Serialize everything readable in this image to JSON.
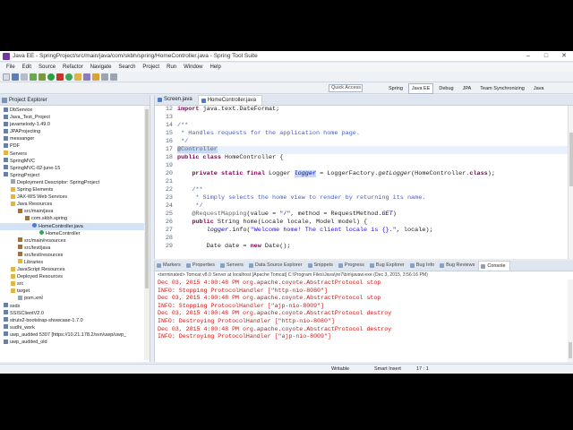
{
  "window": {
    "title": "Java EE - SpringProject/src/main/java/com/skbh/spring/HomeController.java - Spring Tool Suite"
  },
  "menu": [
    "File",
    "Edit",
    "Source",
    "Refactor",
    "Navigate",
    "Search",
    "Project",
    "Run",
    "Window",
    "Help"
  ],
  "quick_access": "Quick Access",
  "perspectives": [
    "Spring",
    "Java EE",
    "Debug",
    "JPA",
    "Team Synchronizing",
    "Java"
  ],
  "explorer": {
    "title": "Project Explorer",
    "items": [
      {
        "label": "DbService",
        "icon": "project-icon"
      },
      {
        "label": "Java_Test_Project",
        "icon": "project-icon"
      },
      {
        "label": "javamelody-1.49.0",
        "icon": "project-icon"
      },
      {
        "label": "JPAProjecting",
        "icon": "project-icon"
      },
      {
        "label": "messanger",
        "icon": "project-icon"
      },
      {
        "label": "PDF",
        "icon": "project-icon"
      },
      {
        "label": "Servers",
        "icon": "folder-icon"
      },
      {
        "label": "SpringMVC",
        "icon": "project-icon"
      },
      {
        "label": "SpringMVC-02-june-15",
        "icon": "project-icon"
      },
      {
        "label": "SpringProject",
        "icon": "project-icon"
      },
      {
        "label": "Deployment Descriptor: SpringProject",
        "icon": "file-icon"
      },
      {
        "label": "Spring Elements",
        "icon": "folder-icon"
      },
      {
        "label": "JAX-WS Web Services",
        "icon": "folder-icon"
      },
      {
        "label": "Java Resources",
        "icon": "folder-icon"
      },
      {
        "label": "src/main/java",
        "icon": "package-icon"
      },
      {
        "label": "com.skbh.spring",
        "icon": "package-icon"
      },
      {
        "label": "HomeController.java",
        "icon": "java-icon"
      },
      {
        "label": "HomeController",
        "icon": "class-icon"
      },
      {
        "label": "src/main/resources",
        "icon": "package-icon"
      },
      {
        "label": "src/test/java",
        "icon": "package-icon"
      },
      {
        "label": "src/test/resources",
        "icon": "package-icon"
      },
      {
        "label": "Libraries",
        "icon": "folder-icon"
      },
      {
        "label": "JavaScript Resources",
        "icon": "folder-icon"
      },
      {
        "label": "Deployed Resources",
        "icon": "folder-icon"
      },
      {
        "label": "src",
        "icon": "folder-icon"
      },
      {
        "label": "target",
        "icon": "folder-icon"
      },
      {
        "label": "pom.xml",
        "icon": "file-icon"
      },
      {
        "label": "ssds",
        "icon": "project-icon"
      },
      {
        "label": "SSISClientV2.0",
        "icon": "project-icon"
      },
      {
        "label": "struts2-bootstrap-showcase-1.7.0",
        "icon": "project-icon"
      },
      {
        "label": "sudhi_work",
        "icon": "project-icon"
      },
      {
        "label": "uwp_audited 5307 [https://10.21.178.2/svn/uwp/uwp_",
        "icon": "project-icon"
      },
      {
        "label": "uwp_audited_old",
        "icon": "project-icon"
      }
    ]
  },
  "editor": {
    "tabs": [
      "Screen.java",
      "HomeController.java"
    ],
    "line_numbers": [
      "12",
      "13",
      "14",
      "15",
      "16",
      "17",
      "18",
      "19",
      "20",
      "21",
      "22",
      "23",
      "24",
      "25",
      "26",
      "27",
      "28",
      "29"
    ]
  },
  "console": {
    "tabs": [
      "Markers",
      "Properties",
      "Servers",
      "Data Source Explorer",
      "Snippets",
      "Progress",
      "Bug Explorer",
      "Bug Info",
      "Bug Reviews",
      "Console"
    ],
    "terminated": "<terminated> Tomcat v8.0 Server at localhost [Apache Tomcat] C:\\Program Files\\Java\\jre7\\bin\\javaw.exe (Dec 3, 2015, 3:56:16 PM)",
    "lines": [
      "Dec 03, 2015 4:00:48 PM org.apache.coyote.AbstractProtocol stop",
      "INFO: Stopping ProtocolHandler [\"http-nio-8080\"]",
      "Dec 03, 2015 4:00:48 PM org.apache.coyote.AbstractProtocol stop",
      "INFO: Stopping ProtocolHandler [\"ajp-nio-8009\"]",
      "Dec 03, 2015 4:00:48 PM org.apache.coyote.AbstractProtocol destroy",
      "INFO: Destroying ProtocolHandler [\"http-nio-8080\"]",
      "Dec 03, 2015 4:00:48 PM org.apache.coyote.AbstractProtocol destroy",
      "INFO: Destroying ProtocolHandler [\"ajp-nio-8009\"]"
    ]
  },
  "status": {
    "writable": "Writable",
    "insert": "Smart Insert",
    "position": "17 : 1"
  }
}
